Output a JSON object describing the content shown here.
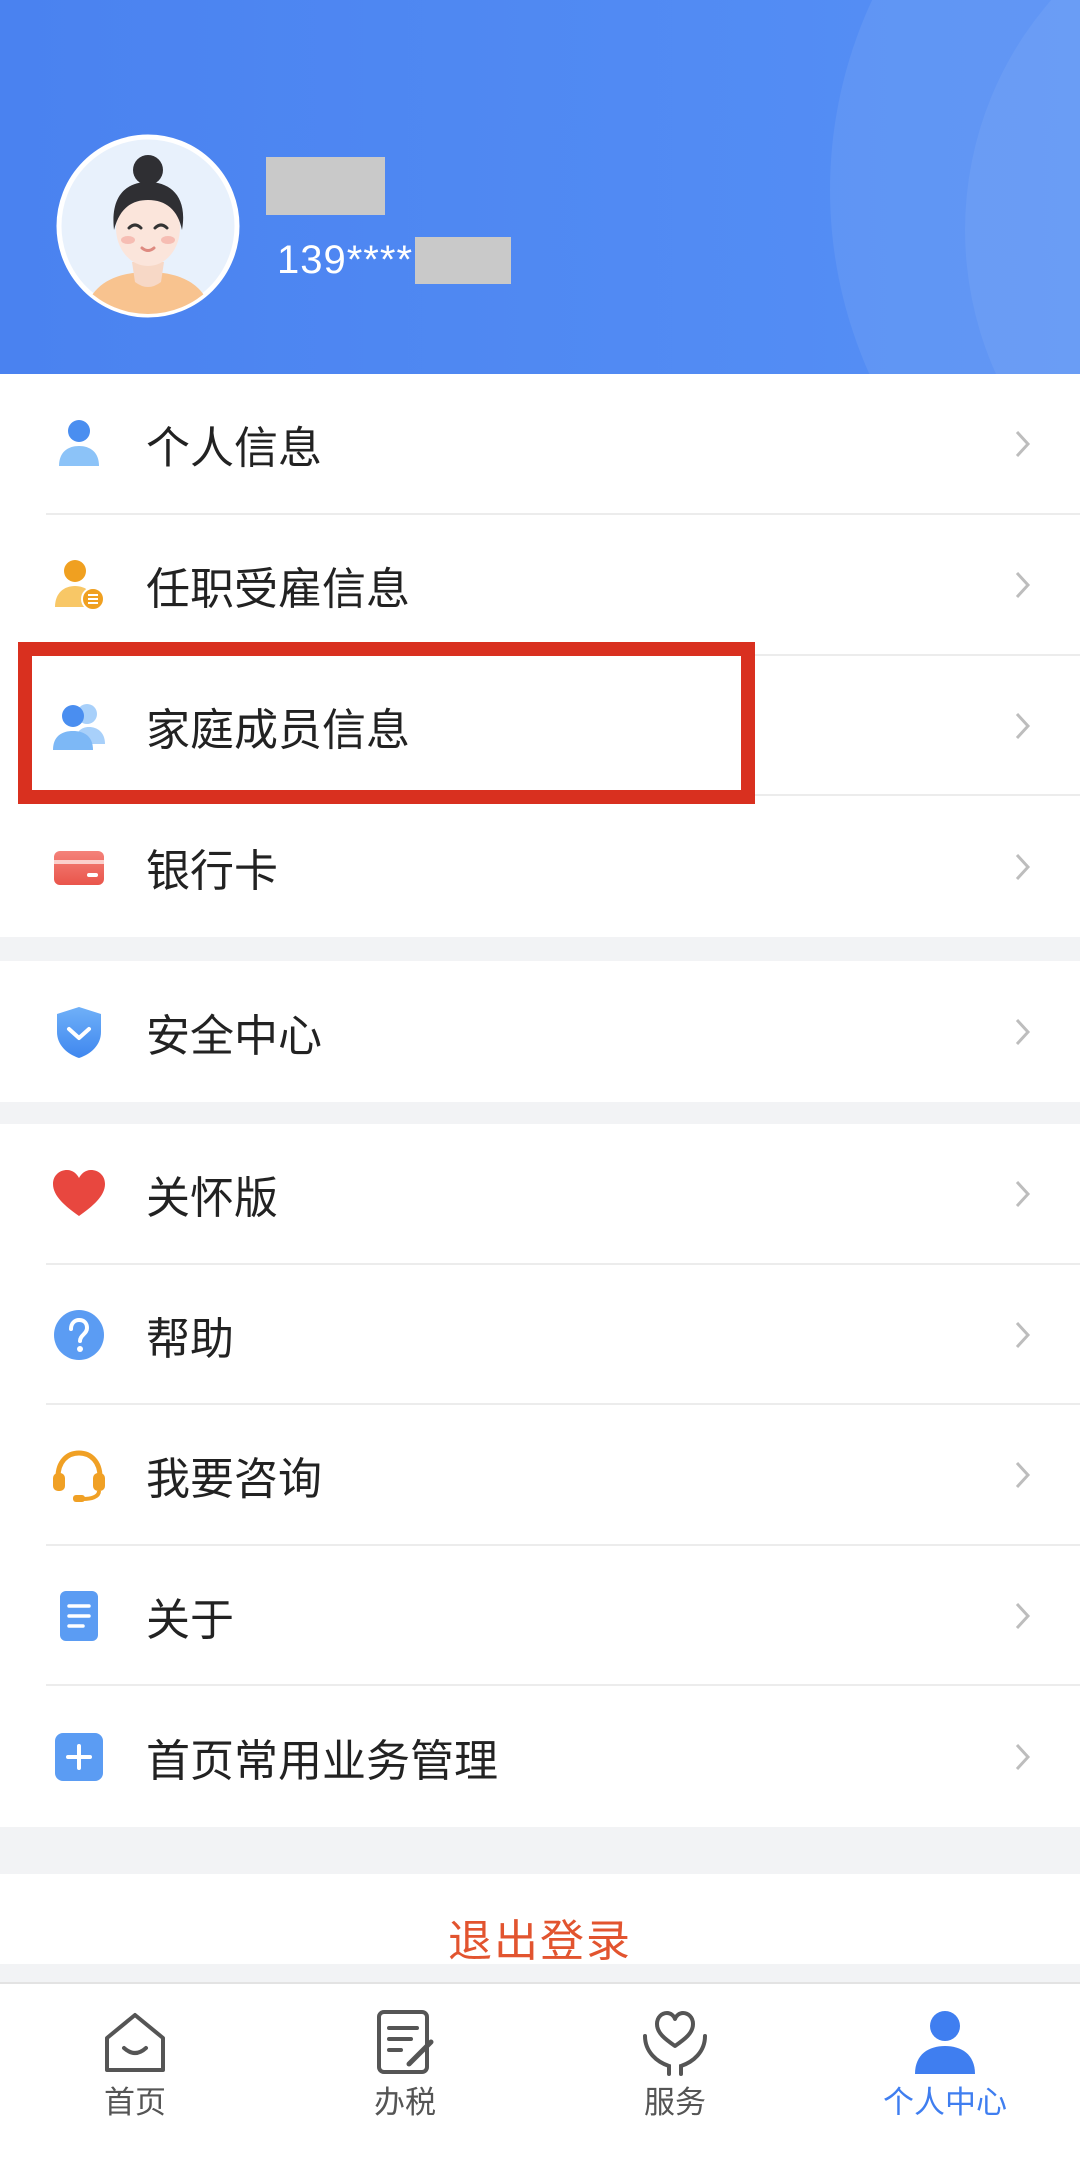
{
  "header": {
    "phone": "139****"
  },
  "groups": [
    {
      "items": [
        {
          "label": "个人信息",
          "icon": "person-icon"
        },
        {
          "label": "任职受雇信息",
          "icon": "employment-icon"
        },
        {
          "label": "家庭成员信息",
          "icon": "family-icon"
        },
        {
          "label": "银行卡",
          "icon": "bank-card-icon"
        }
      ]
    },
    {
      "items": [
        {
          "label": "安全中心",
          "icon": "shield-icon"
        }
      ]
    },
    {
      "items": [
        {
          "label": "关怀版",
          "icon": "heart-icon"
        },
        {
          "label": "帮助",
          "icon": "help-icon"
        },
        {
          "label": "我要咨询",
          "icon": "headset-icon"
        },
        {
          "label": "关于",
          "icon": "document-icon"
        },
        {
          "label": "首页常用业务管理",
          "icon": "plus-icon"
        }
      ]
    }
  ],
  "logout": {
    "label": "退出登录"
  },
  "tabs": [
    {
      "label": "首页",
      "icon": "home-icon",
      "active": false
    },
    {
      "label": "办税",
      "icon": "tax-document-icon",
      "active": false
    },
    {
      "label": "服务",
      "icon": "service-heart-icon",
      "active": false
    },
    {
      "label": "个人中心",
      "icon": "user-center-icon",
      "active": true
    }
  ],
  "colors": {
    "header_blue": "#4f86f2",
    "accent": "#3f7ef0",
    "highlight": "#d9301f",
    "logout": "#e2542f"
  }
}
